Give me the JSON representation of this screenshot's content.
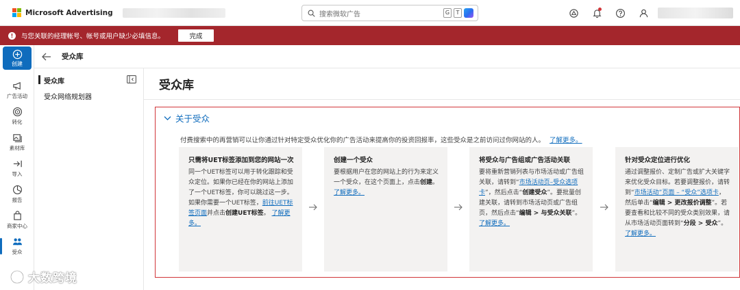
{
  "topbar": {
    "brand": "Microsoft Advertising",
    "search_placeholder": "搜索微软广告",
    "search_badge_g": "G",
    "search_badge_t": "T"
  },
  "colors": {
    "accent": "#0f6cbd",
    "alert": "#a4262c",
    "highlight_border": "#d13438"
  },
  "alert": {
    "icon": "!",
    "text": "与您关联的经理帐号、帐号或用户缺少必填信息。",
    "button": "完成"
  },
  "leftnav": {
    "create": "创建",
    "items": [
      {
        "label": "广告活动",
        "icon": "megaphone-icon"
      },
      {
        "label": "转化",
        "icon": "target-icon"
      },
      {
        "label": "素材库",
        "icon": "image-library-icon"
      },
      {
        "label": "导入",
        "icon": "import-icon"
      },
      {
        "label": "报告",
        "icon": "chart-icon"
      },
      {
        "label": "商家中心",
        "icon": "shopping-bag-icon"
      },
      {
        "label": "受众",
        "icon": "people-icon"
      }
    ]
  },
  "breadcrumb": {
    "title": "受众库"
  },
  "subnav": {
    "items": [
      {
        "label": "受众库"
      },
      {
        "label": "受众网络规划器"
      }
    ]
  },
  "main": {
    "title": "受众库",
    "about": {
      "title": "关于受众",
      "description": "付费搜索中的再营销可以让你通过针对特定受众优化你的广告活动来提高你的投资回报率，这些受众是之前访问过你网站的人。",
      "learn_more": "了解更多。"
    },
    "steps": [
      {
        "title": "只需将UET标签添加到您的网站一次",
        "t1": "同一个UET标签可以用于转化跟踪和受众定位。如果你已经在你的网站上添加了一个UET标签，你可以跳过这一步。如果你需要一个UET标签，",
        "link1": "前往UET标签页面",
        "t2": "并点击",
        "b1": "创建UET标签",
        "t3": "。",
        "learn": "了解更多。"
      },
      {
        "title": "创建一个受众",
        "t1": "要根据用户在您的网站上的行为来定义一个受众，在这个页面上，点击",
        "b1": "创建",
        "t2": "。",
        "learn": "了解更多。"
      },
      {
        "title": "将受众与广告组或广告活动关联",
        "t1": "要将重新营销列表与市场活动或广告组关联，请转到“",
        "link1": "市场活动页–受众选项卡",
        "t2": "”，然后点击“",
        "b1": "创建受众",
        "t3": "”。要批量创建关联，请转到市场活动页或广告组页，然后点击“",
        "b2": "编辑 > 与受众关联",
        "t4": "”。",
        "learn": "了解更多。"
      },
      {
        "title": "针对受众定位进行优化",
        "t1": "通过调整报价、定制广告或扩大关键字来优化受众目标。若要调整报价，请转到“",
        "link1": "市场活动”页面 – “受众”选项卡",
        "t2": "，然后单击“",
        "b1": "编辑 > 更改报价调整",
        "t3": "”。若要查看和比较不同的受众类别效果，请从市场活动页面转到“",
        "b2": "分段 > 受众",
        "t4": "”。",
        "learn": "了解更多。"
      }
    ]
  },
  "watermark": {
    "text": "大数跨境"
  }
}
